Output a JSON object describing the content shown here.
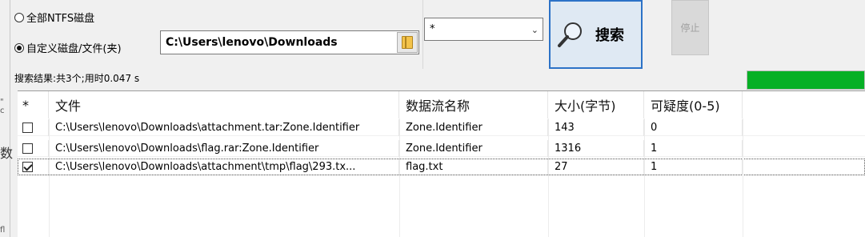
{
  "scope": {
    "all_ntfs_label": "全部NTFS磁盘",
    "custom_label": "自定义磁盘/文件(夹)",
    "selected": "custom",
    "path_value": "C:\\Users\\lenovo\\Downloads"
  },
  "filter": {
    "value": "*"
  },
  "buttons": {
    "search_label": "搜索",
    "stop_label": "停止"
  },
  "status": {
    "text": "搜索结果:共3个;用时0.047 s",
    "progress_fraction": 1.0
  },
  "table": {
    "headers": [
      "*",
      "文件",
      "数据流名称",
      "大小(字节)",
      "可疑度(0-5)"
    ],
    "rows": [
      {
        "checked": false,
        "file": "C:\\Users\\lenovo\\Downloads\\attachment.tar:Zone.Identifier",
        "stream": "Zone.Identifier",
        "size": "143",
        "suspicion": "0"
      },
      {
        "checked": false,
        "file": "C:\\Users\\lenovo\\Downloads\\flag.rar:Zone.Identifier",
        "stream": "Zone.Identifier",
        "size": "1316",
        "suspicion": "1"
      },
      {
        "checked": true,
        "file": "C:\\Users\\lenovo\\Downloads\\attachment\\tmp\\flag\\293.tx...",
        "stream": "flag.txt",
        "size": "27",
        "suspicion": "1"
      }
    ]
  },
  "colors": {
    "accent": "#2c72c7",
    "progress": "#06b025"
  },
  "icons": {
    "folder": "folder-icon",
    "search": "magnifier-icon",
    "chevron": "chevron-down-icon"
  }
}
